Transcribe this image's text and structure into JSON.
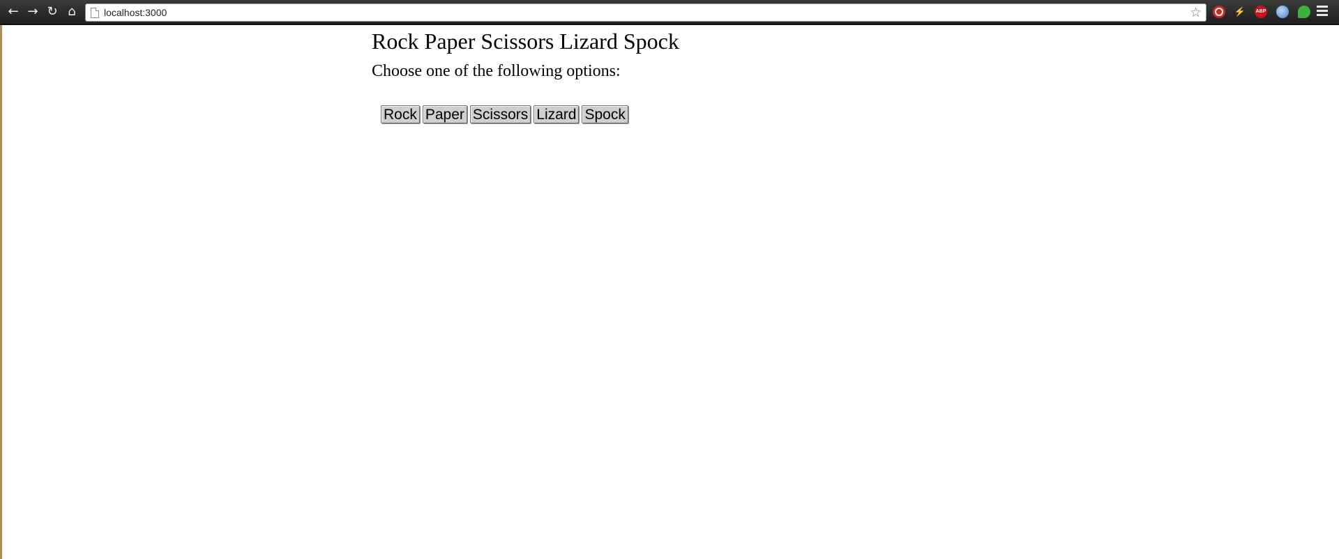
{
  "browser": {
    "url": "localhost:3000",
    "icons": {
      "back": "back-arrow-icon",
      "forward": "forward-arrow-icon",
      "reload": "reload-icon",
      "home": "home-icon",
      "bookmark": "bookmark-star-icon",
      "menu": "hamburger-menu-icon"
    },
    "extensions": [
      {
        "name": "stop-extension-icon",
        "label": "",
        "color": "#d0271f"
      },
      {
        "name": "bolt-extension-icon",
        "label": "⚡",
        "color": "#555555"
      },
      {
        "name": "adblock-plus-icon",
        "label": "ABP",
        "color": "#c4171d"
      },
      {
        "name": "globe-extension-icon",
        "label": "",
        "color": "#4a7fc8"
      },
      {
        "name": "evernote-extension-icon",
        "label": "",
        "color": "#3fae3f"
      }
    ]
  },
  "page": {
    "title": "Rock Paper Scissors Lizard Spock",
    "instructions": "Choose one of the following options:",
    "options": [
      "Rock",
      "Paper",
      "Scissors",
      "Lizard",
      "Spock"
    ]
  }
}
